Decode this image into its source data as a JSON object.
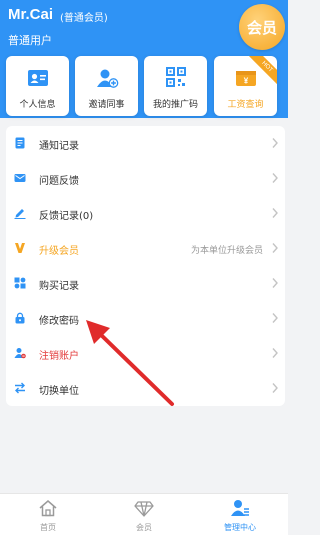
{
  "header": {
    "user_name": "Mr.Cai",
    "user_level": "(普通会员)",
    "user_role": "普通用户",
    "vip_badge": "会员",
    "colors": {
      "background": "#2f93f5",
      "badge": "#f5a623"
    }
  },
  "shortcuts": [
    {
      "label": "个人信息",
      "icon": "id-card-icon"
    },
    {
      "label": "邀请同事",
      "icon": "add-user-icon"
    },
    {
      "label": "我的推广码",
      "icon": "qr-code-icon"
    },
    {
      "label": "工资查询",
      "icon": "wallet-icon",
      "ribbon": "HOT"
    }
  ],
  "menu": {
    "items": [
      {
        "label": "通知记录",
        "icon": "document-icon"
      },
      {
        "label": "问题反馈",
        "icon": "mail-icon"
      },
      {
        "label": "反馈记录(0)",
        "icon": "edit-icon"
      },
      {
        "label": "升级会员",
        "icon": "upgrade-icon",
        "hint": "为本单位升级会员",
        "color": "#f5a623"
      },
      {
        "label": "购买记录",
        "icon": "puzzle-icon"
      },
      {
        "label": "修改密码",
        "icon": "lock-icon"
      },
      {
        "label": "注销账户",
        "icon": "user-remove-icon",
        "color": "#e33c3c"
      },
      {
        "label": "切换单位",
        "icon": "switch-icon"
      }
    ]
  },
  "tabbar": {
    "tabs": [
      {
        "label": "首页",
        "icon": "home-icon"
      },
      {
        "label": "会员",
        "icon": "diamond-icon"
      },
      {
        "label": "管理中心",
        "icon": "user-center-icon",
        "active": true
      }
    ],
    "active_color": "#2f93f5"
  },
  "annotation_color": "#e02b2b"
}
